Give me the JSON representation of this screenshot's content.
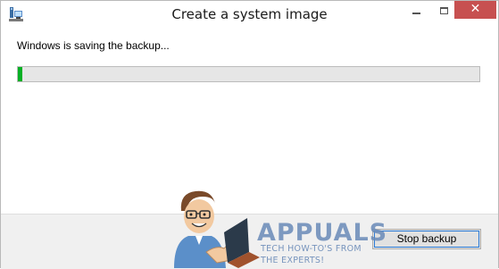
{
  "window": {
    "title": "Create a system image",
    "app_icon": "system-image-backup-icon",
    "controls": {
      "minimize_icon": "minimize-icon",
      "maximize_icon": "maximize-icon",
      "close_icon": "close-icon",
      "close_glyph": "✕"
    }
  },
  "main": {
    "status_text": "Windows is saving the backup...",
    "progress": {
      "percent": 1,
      "fill_color": "#06b025"
    }
  },
  "footer": {
    "stop_button_label": "Stop backup"
  },
  "watermark": {
    "brand": "APPUALS",
    "tagline_line1": "TECH HOW-TO'S FROM",
    "tagline_line2": "THE EXPERTS!",
    "mascot_icon": "appuals-mascot-icon"
  },
  "colors": {
    "close_button": "#c75050",
    "progress_fill": "#06b025",
    "watermark": "#6a8bb8"
  }
}
